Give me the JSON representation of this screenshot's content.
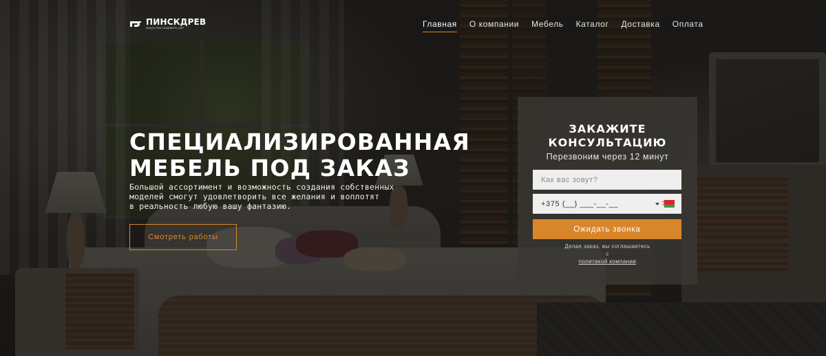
{
  "header": {
    "logo": {
      "name": "ПИНСКДРЕВ",
      "tagline": "искусство создавать уют"
    },
    "nav": [
      {
        "label": "Главная",
        "active": true
      },
      {
        "label": "О компании",
        "active": false
      },
      {
        "label": "Мебель",
        "active": false
      },
      {
        "label": "Каталог",
        "active": false
      },
      {
        "label": "Доставка",
        "active": false
      },
      {
        "label": "Оплата",
        "active": false
      }
    ]
  },
  "hero": {
    "title_lines": [
      "СПЕЦИАЛИЗИРОВАННАЯ",
      "МЕБЕЛЬ ПОД ЗАКАЗ"
    ],
    "text_lines": [
      "Большой ассортимент и возможность создания собственных",
      "моделей смогут удовлетворить все желания и воплотят",
      "в реальность любую вашу фантазию."
    ],
    "button_label": "Смотреть работы"
  },
  "form": {
    "title_lines": [
      "ЗАКАЖИТЕ",
      "КОНСУЛЬТАЦИЮ"
    ],
    "subtitle": "Перезвоним через 12 минут",
    "name_placeholder": "Как вас зовут?",
    "phone_value": "+375 (__) ___-__-__",
    "country_icon": "belarus-flag-icon",
    "submit_label": "Ожидать звонка",
    "consent_prefix": "Делая заказ, вы соглашаетесь",
    "consent_link_prefix": "с ",
    "consent_link": "политикой компании"
  },
  "colors": {
    "accent": "#d8862a",
    "panel": "#3a3835",
    "field_bg": "#efefef"
  }
}
